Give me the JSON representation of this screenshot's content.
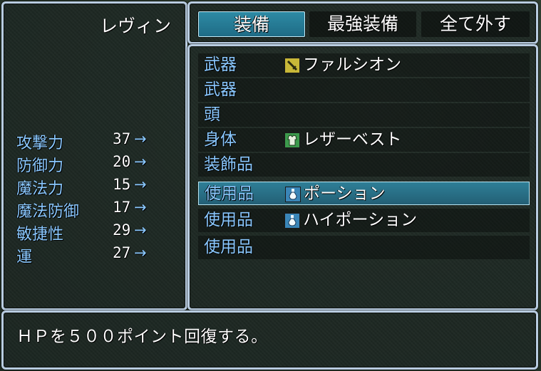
{
  "actor": {
    "name": "レヴィン"
  },
  "stats": [
    {
      "label": "攻撃力",
      "value": "37",
      "arrow": "→"
    },
    {
      "label": "防御力",
      "value": "20",
      "arrow": "→"
    },
    {
      "label": "魔法力",
      "value": "15",
      "arrow": "→"
    },
    {
      "label": "魔法防御",
      "value": "17",
      "arrow": "→"
    },
    {
      "label": "敏捷性",
      "value": "29",
      "arrow": "→"
    },
    {
      "label": "運",
      "value": "27",
      "arrow": "→"
    }
  ],
  "commands": [
    {
      "label": "装備",
      "selected": true
    },
    {
      "label": "最強装備",
      "selected": false
    },
    {
      "label": "全て外す",
      "selected": false
    }
  ],
  "slots": [
    {
      "slot": "武器",
      "item": "ファルシオン",
      "icon": "sword-icon"
    },
    {
      "slot": "武器",
      "item": "",
      "icon": ""
    },
    {
      "slot": "頭",
      "item": "",
      "icon": ""
    },
    {
      "slot": "身体",
      "item": "レザーベスト",
      "icon": "armor-icon"
    },
    {
      "slot": "装飾品",
      "item": "",
      "icon": ""
    },
    {
      "slot": "使用品",
      "item": "ポーション",
      "icon": "potion-icon",
      "selected": true
    },
    {
      "slot": "使用品",
      "item": "ハイポーション",
      "icon": "potion-icon"
    },
    {
      "slot": "使用品",
      "item": "",
      "icon": ""
    }
  ],
  "help": {
    "text": "ＨＰを５００ポイント回復する。"
  },
  "colors": {
    "system": "#8ac8ff",
    "frame": "#b8cce0",
    "cursor": "#2e7f97"
  }
}
